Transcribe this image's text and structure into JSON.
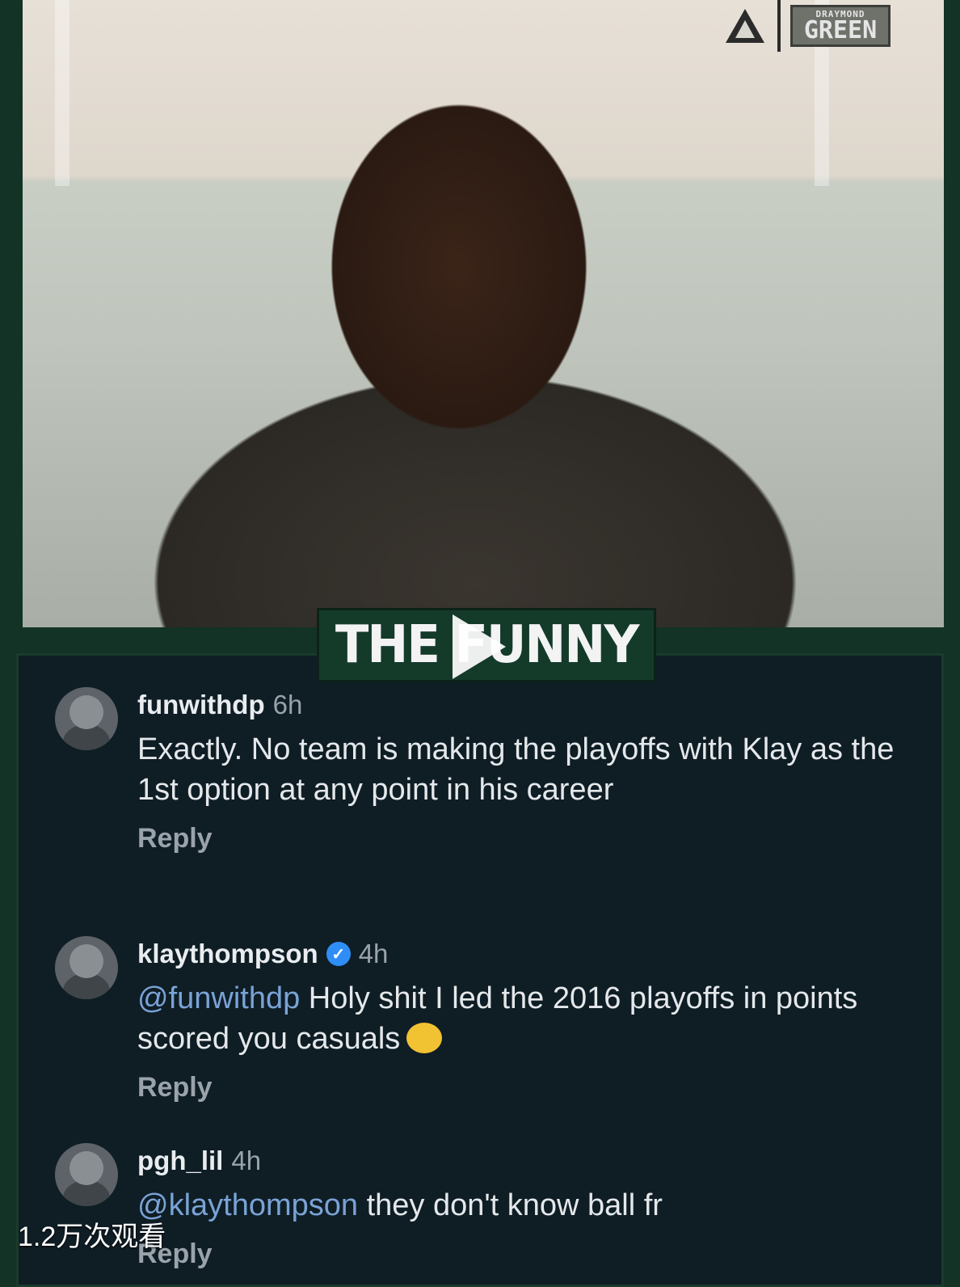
{
  "logo": {
    "top_text": "DRAYMOND",
    "main_text": "GREEN"
  },
  "banner": {
    "text": "THE FUNNY"
  },
  "comments": [
    {
      "username": "funwithdp",
      "time": "6h",
      "verified": false,
      "mention": "",
      "text": "Exactly. No team is making the playoffs with Klay as the 1st option at any point in his career",
      "reply": "Reply"
    },
    {
      "username": "klaythompson",
      "time": "4h",
      "verified": true,
      "mention": "@funwithdp",
      "text": " Holy shit I led the 2016 playoffs in points scored you casuals",
      "emoji": "laughing-emoji",
      "reply": "Reply"
    },
    {
      "username": "pgh_lil",
      "time": "4h",
      "verified": false,
      "mention": "@klaythompson",
      "text": " they don't know ball fr",
      "reply": "Reply"
    }
  ],
  "overlay": {
    "views": "1.2万次观看"
  },
  "colors": {
    "frame": "#123326",
    "panel": "#0f1d25",
    "mention": "#7aa3d6",
    "verified": "#2f8ef5"
  }
}
